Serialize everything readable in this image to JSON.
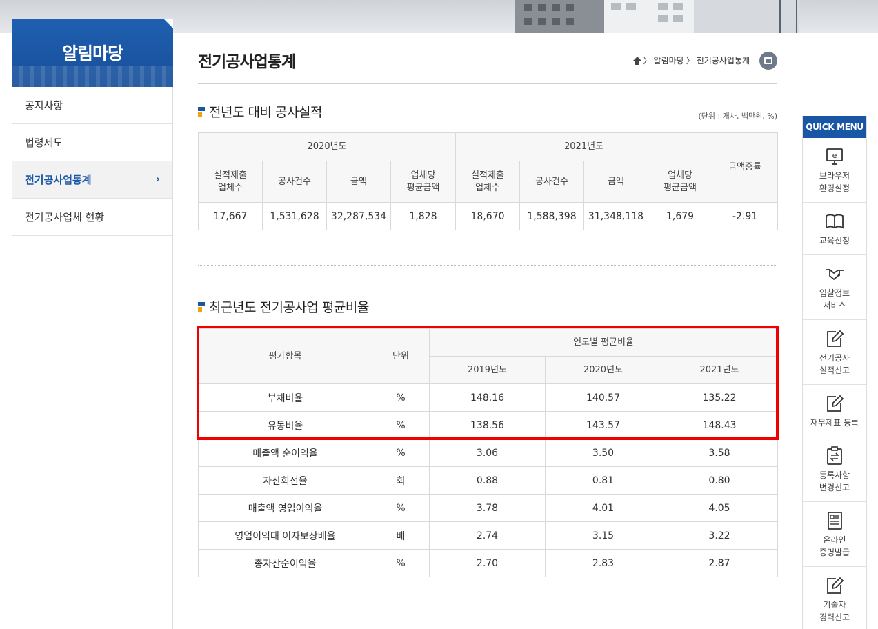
{
  "sidebar": {
    "title": "알림마당",
    "items": [
      {
        "label": "공지사항"
      },
      {
        "label": "법령제도"
      },
      {
        "label": "전기공사업통계",
        "active": true
      },
      {
        "label": "전기공사업체 현황"
      }
    ]
  },
  "header": {
    "title": "전기공사업통계",
    "breadcrumb": [
      "알림마당",
      "전기공사업통계"
    ]
  },
  "section1": {
    "title": "전년도 대비 공사실적",
    "unit": "(단위 : 개사, 백만원, %)",
    "years": [
      "2020년도",
      "2021년도"
    ],
    "columns": [
      "실적제출\n업체수",
      "공사건수",
      "금액",
      "업체당\n평균금액"
    ],
    "growth_header": "금액증률",
    "row": [
      "17,667",
      "1,531,628",
      "32,287,534",
      "1,828",
      "18,670",
      "1,588,398",
      "31,348,118",
      "1,679",
      "-2.91"
    ]
  },
  "section2": {
    "title": "최근년도 전기공사업 평균비율",
    "headers": {
      "item": "평가항목",
      "unit": "단위",
      "group": "연도별 평균비율",
      "years": [
        "2019년도",
        "2020년도",
        "2021년도"
      ]
    },
    "rows": [
      {
        "item": "부채비율",
        "unit": "%",
        "values": [
          "148.16",
          "140.57",
          "135.22"
        ]
      },
      {
        "item": "유동비율",
        "unit": "%",
        "values": [
          "138.56",
          "143.57",
          "148.43"
        ]
      },
      {
        "item": "매출액 순이익율",
        "unit": "%",
        "values": [
          "3.06",
          "3.50",
          "3.58"
        ]
      },
      {
        "item": "자산회전율",
        "unit": "회",
        "values": [
          "0.88",
          "0.81",
          "0.80"
        ]
      },
      {
        "item": "매출액 영업이익율",
        "unit": "%",
        "values": [
          "3.78",
          "4.01",
          "4.05"
        ]
      },
      {
        "item": "영업이익대 이자보상배율",
        "unit": "배",
        "values": [
          "2.74",
          "3.15",
          "3.22"
        ]
      },
      {
        "item": "총자산순이익율",
        "unit": "%",
        "values": [
          "2.70",
          "2.83",
          "2.87"
        ]
      }
    ]
  },
  "quick_menu": {
    "title": "QUICK MENU",
    "items": [
      {
        "label": "브라우저\n환경설정",
        "icon": "browser-icon"
      },
      {
        "label": "교육신청",
        "icon": "book-icon"
      },
      {
        "label": "입찰정보\n서비스",
        "icon": "handshake-icon"
      },
      {
        "label": "전기공사\n실적신고",
        "icon": "edit-icon"
      },
      {
        "label": "재무제표 등록",
        "icon": "edit-icon"
      },
      {
        "label": "등록사항\n변경신고",
        "icon": "clipboard-icon"
      },
      {
        "label": "온라인\n증명발급",
        "icon": "document-icon"
      },
      {
        "label": "기술자\n경력신고",
        "icon": "edit-icon"
      }
    ]
  },
  "colors": {
    "brand": "#1a56a6",
    "highlight": "#f10000",
    "accent": "#f0a30a"
  }
}
